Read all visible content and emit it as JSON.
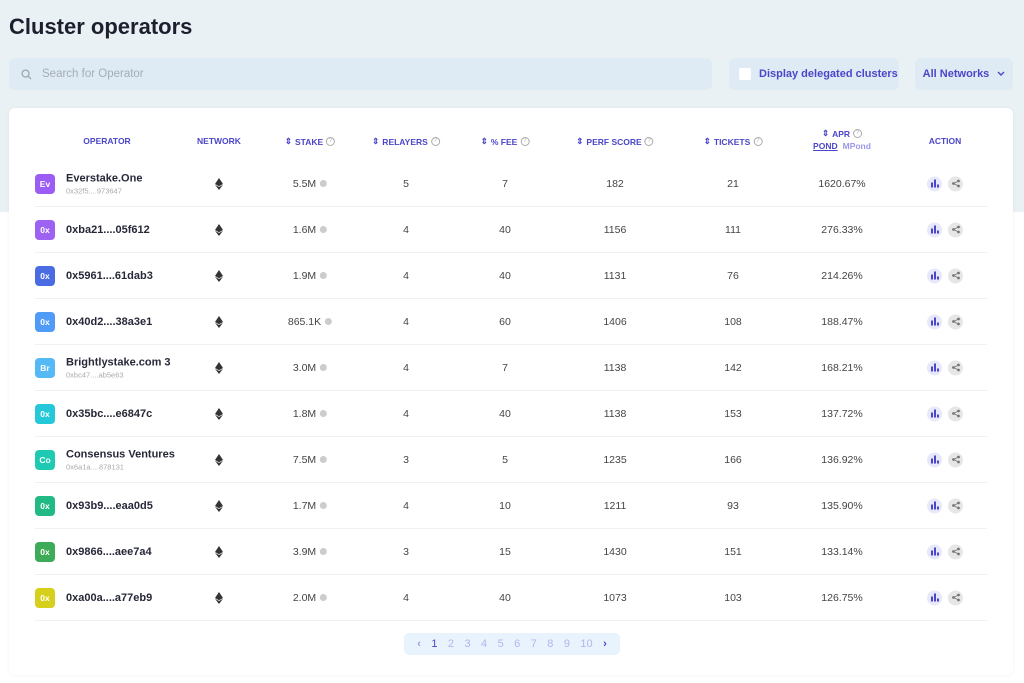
{
  "title": "Cluster operators",
  "search": {
    "placeholder": "Search for Operator"
  },
  "delegated_label": "Display delegated clusters",
  "network_filter": "All Networks",
  "headers": {
    "operator": "OPERATOR",
    "network": "NETWORK",
    "stake": "STAKE",
    "relayers": "RELAYERS",
    "fee": "% FEE",
    "perf": "PERF SCORE",
    "tickets": "TICKETS",
    "apr": "APR",
    "apr_pond": "POND",
    "apr_mpond": "MPond",
    "action": "ACTION"
  },
  "rows": [
    {
      "avatar": "Ev",
      "color": "#9c5cf6",
      "name": "Everstake.One",
      "address": "0x32f5....973647",
      "stake": "5.5M",
      "relayers": "5",
      "fee": "7",
      "perf": "182",
      "tickets": "21",
      "apr": "1620.67%"
    },
    {
      "avatar": "0x",
      "color": "#9d62f2",
      "name": "0xba21....05f612",
      "address": "",
      "stake": "1.6M",
      "relayers": "4",
      "fee": "40",
      "perf": "1156",
      "tickets": "111",
      "apr": "276.33%"
    },
    {
      "avatar": "0x",
      "color": "#4a6ce2",
      "name": "0x5961....61dab3",
      "address": "",
      "stake": "1.9M",
      "relayers": "4",
      "fee": "40",
      "perf": "1131",
      "tickets": "76",
      "apr": "214.26%"
    },
    {
      "avatar": "0x",
      "color": "#4f9bf6",
      "name": "0x40d2....38a3e1",
      "address": "",
      "stake": "865.1K",
      "relayers": "4",
      "fee": "60",
      "perf": "1406",
      "tickets": "108",
      "apr": "188.47%"
    },
    {
      "avatar": "Br",
      "color": "#55b9f6",
      "name": "Brightlystake.com 3",
      "address": "0xbc47....ab5e63",
      "stake": "3.0M",
      "relayers": "4",
      "fee": "7",
      "perf": "1138",
      "tickets": "142",
      "apr": "168.21%"
    },
    {
      "avatar": "0x",
      "color": "#25c8d8",
      "name": "0x35bc....e6847c",
      "address": "",
      "stake": "1.8M",
      "relayers": "4",
      "fee": "40",
      "perf": "1138",
      "tickets": "153",
      "apr": "137.72%"
    },
    {
      "avatar": "Co",
      "color": "#1fcab2",
      "name": "Consensus Ventures",
      "address": "0x6a1a....878131",
      "stake": "7.5M",
      "relayers": "3",
      "fee": "5",
      "perf": "1235",
      "tickets": "166",
      "apr": "136.92%"
    },
    {
      "avatar": "0x",
      "color": "#21ba84",
      "name": "0x93b9....eaa0d5",
      "address": "",
      "stake": "1.7M",
      "relayers": "4",
      "fee": "10",
      "perf": "1211",
      "tickets": "93",
      "apr": "135.90%"
    },
    {
      "avatar": "0x",
      "color": "#3dab57",
      "name": "0x9866....aee7a4",
      "address": "",
      "stake": "3.9M",
      "relayers": "3",
      "fee": "15",
      "perf": "1430",
      "tickets": "151",
      "apr": "133.14%"
    },
    {
      "avatar": "0x",
      "color": "#d6cf1c",
      "name": "0xa00a....a77eb9",
      "address": "",
      "stake": "2.0M",
      "relayers": "4",
      "fee": "40",
      "perf": "1073",
      "tickets": "103",
      "apr": "126.75%"
    }
  ],
  "pagination": {
    "pages": [
      "1",
      "2",
      "3",
      "4",
      "5",
      "6",
      "7",
      "8",
      "9",
      "10"
    ],
    "current": "1"
  }
}
